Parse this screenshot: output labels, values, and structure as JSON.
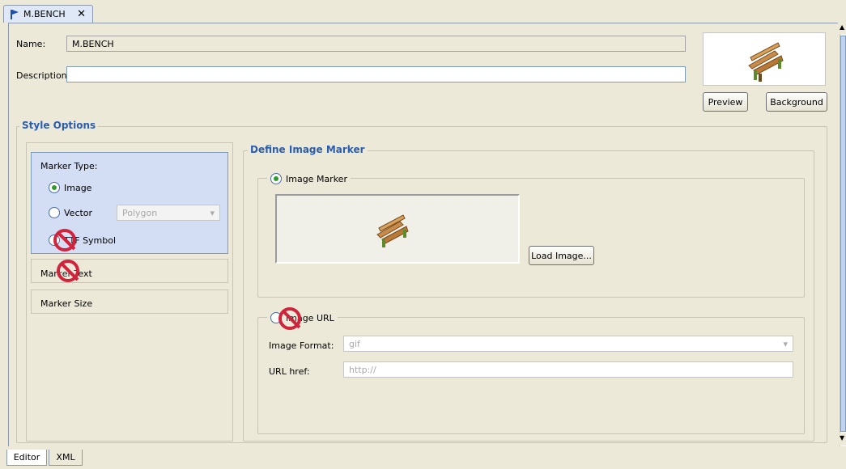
{
  "tab": {
    "title": "M.BENCH"
  },
  "form": {
    "name_label": "Name:",
    "name_value": "M.BENCH",
    "description_label": "Description:",
    "description_value": ""
  },
  "preview": {
    "preview_label": "Preview",
    "background_label": "Background"
  },
  "style_options": {
    "title": "Style Options",
    "marker_type": {
      "title": "Marker Type:",
      "options": {
        "image": "Image",
        "vector": "Vector",
        "symbol": "TTF Symbol"
      },
      "vector_select": "Polygon",
      "selected": "image"
    },
    "marker_text_label": "Marker Text",
    "marker_size_label": "Marker Size"
  },
  "define": {
    "title": "Define Image Marker",
    "image_marker_label": "Image Marker",
    "load_image_label": "Load Image...",
    "image_url_label": "Image URL",
    "image_format_label": "Image Format:",
    "image_format_value": "gif",
    "url_href_label": "URL href:",
    "url_href_value": "http://"
  },
  "bottom_tabs": {
    "editor": "Editor",
    "xml": "XML"
  },
  "colors": {
    "panel": "#ece9d8",
    "accent_title": "#2a5db0",
    "selected_panel": "#d3ddf4"
  }
}
